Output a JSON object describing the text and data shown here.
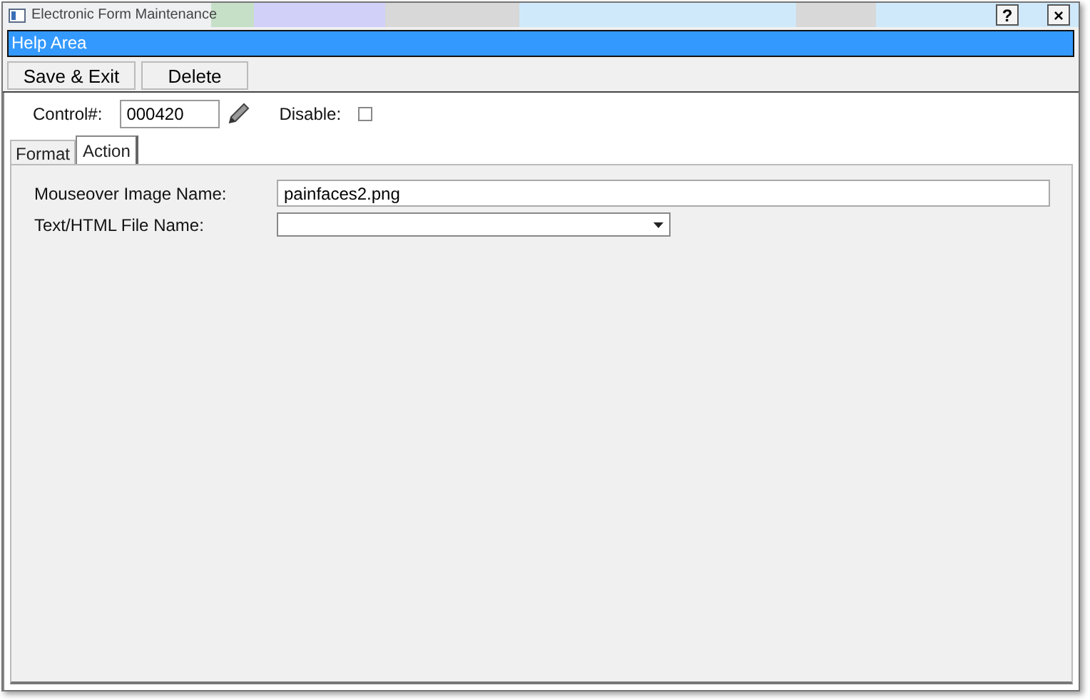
{
  "window": {
    "title": "Electronic Form Maintenance",
    "help_button": "?",
    "close_button": "×"
  },
  "help_area": "Help Area",
  "toolbar": [
    "Save & Exit",
    "Delete"
  ],
  "control": {
    "label": "Control#:",
    "value": "000420"
  },
  "disable": {
    "label": "Disable:",
    "checked": false
  },
  "tabs": [
    {
      "label": "Format",
      "selected": false
    },
    {
      "label": "Action",
      "selected": true
    }
  ],
  "fields": [
    {
      "kind": "text",
      "label": "Mouseover Image Name:",
      "value": "painfaces2.png"
    },
    {
      "kind": "dropdown",
      "label": "Text/HTML File Name:"
    }
  ]
}
